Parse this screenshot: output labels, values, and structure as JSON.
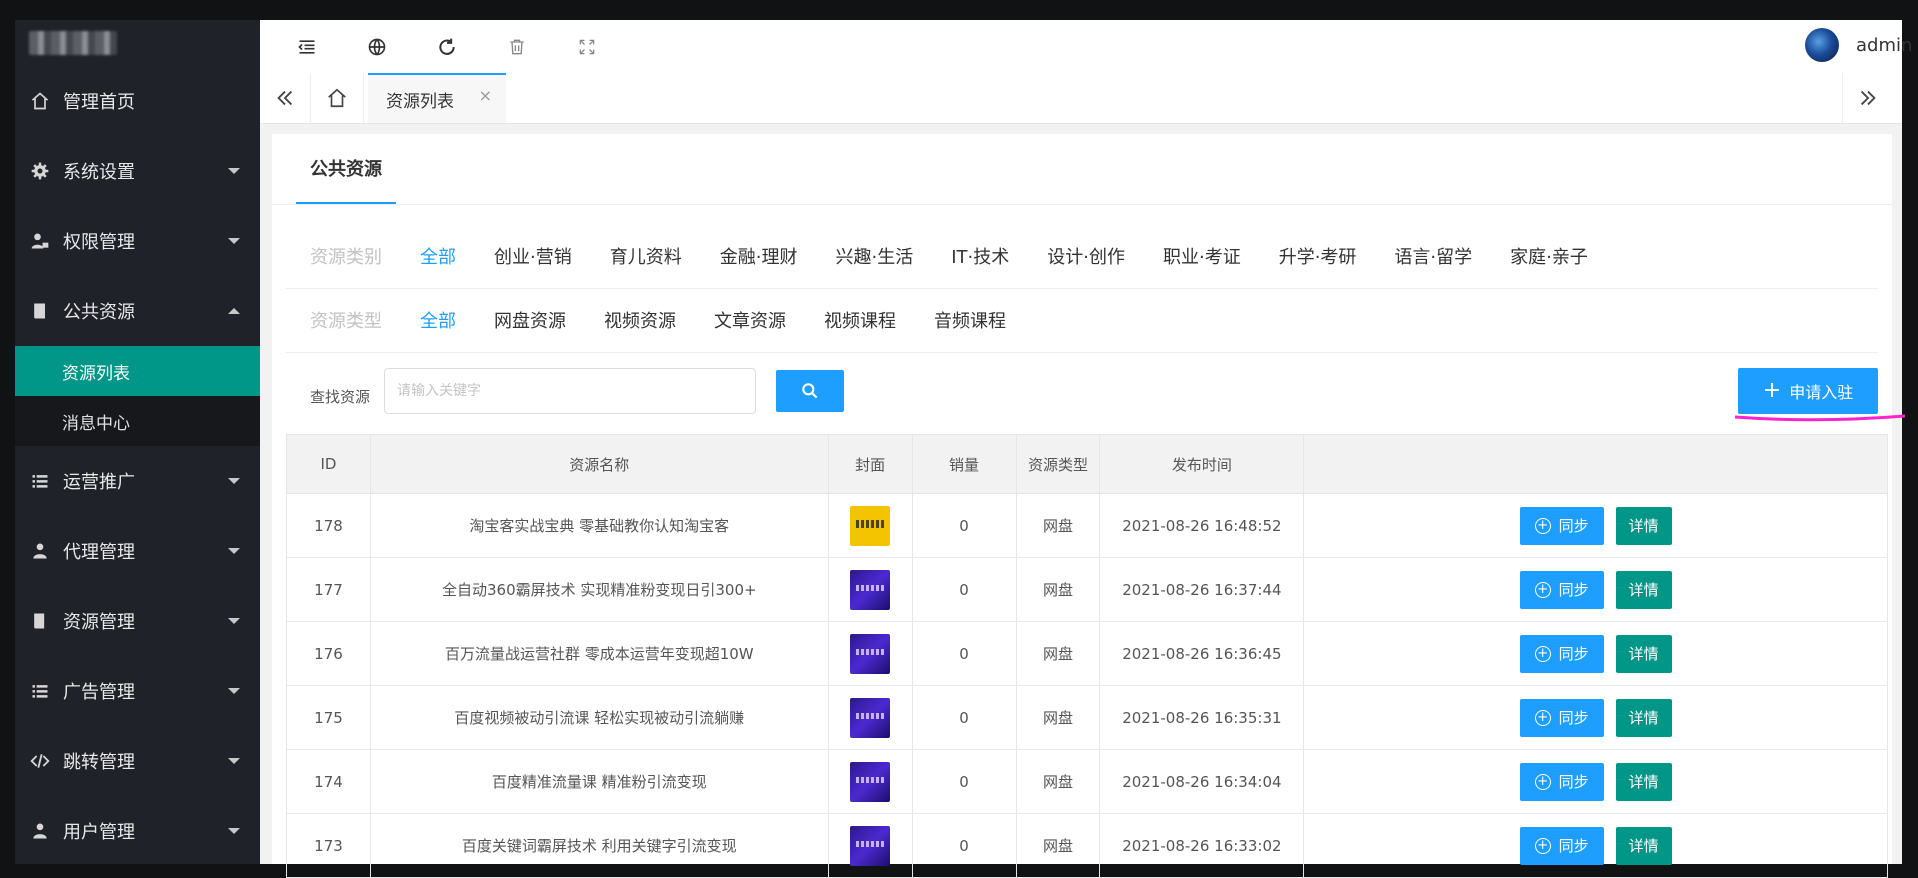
{
  "user": {
    "name": "admin"
  },
  "sidebar": {
    "items": [
      {
        "label": "管理首页",
        "icon": "home-icon",
        "expandable": false
      },
      {
        "label": "系统设置",
        "icon": "gear-icon",
        "expandable": true
      },
      {
        "label": "权限管理",
        "icon": "user-lock-icon",
        "expandable": true
      },
      {
        "label": "公共资源",
        "icon": "book-icon",
        "expandable": true,
        "open": true,
        "children": [
          {
            "label": "资源列表",
            "active": true
          },
          {
            "label": "消息中心"
          }
        ]
      },
      {
        "label": "运营推广",
        "icon": "list-icon",
        "expandable": true
      },
      {
        "label": "代理管理",
        "icon": "agent-icon",
        "expandable": true
      },
      {
        "label": "资源管理",
        "icon": "book-icon",
        "expandable": true
      },
      {
        "label": "广告管理",
        "icon": "list-icon",
        "expandable": true
      },
      {
        "label": "跳转管理",
        "icon": "code-icon",
        "expandable": true
      },
      {
        "label": "用户管理",
        "icon": "user-icon",
        "expandable": true
      }
    ]
  },
  "tabs": {
    "active_label": "资源列表",
    "close_glyph": "×"
  },
  "card": {
    "tab_label": "公共资源",
    "category": {
      "label": "资源类别",
      "options": [
        "全部",
        "创业·营销",
        "育儿资料",
        "金融·理财",
        "兴趣·生活",
        "IT·技术",
        "设计·创作",
        "职业·考证",
        "升学·考研",
        "语言·留学",
        "家庭·亲子"
      ],
      "active": 0
    },
    "type": {
      "label": "资源类型",
      "options": [
        "全部",
        "网盘资源",
        "视频资源",
        "文章资源",
        "视频课程",
        "音频课程"
      ],
      "active": 0
    },
    "search": {
      "label": "查找资源",
      "placeholder": "请输入关键字",
      "value": ""
    },
    "apply_label": "申请入驻"
  },
  "table": {
    "headers": [
      "ID",
      "资源名称",
      "封面",
      "销量",
      "资源类型",
      "发布时间",
      ""
    ],
    "sync_label": "同步",
    "detail_label": "详情",
    "rows": [
      {
        "id": "178",
        "name": "淘宝客实战宝典 零基础教你认知淘宝客",
        "sales": "0",
        "type": "网盘",
        "time": "2021-08-26 16:48:52",
        "cover": "yellow"
      },
      {
        "id": "177",
        "name": "全自动360霸屏技术 实现精准粉变现日引300+",
        "sales": "0",
        "type": "网盘",
        "time": "2021-08-26 16:37:44",
        "cover": "purple"
      },
      {
        "id": "176",
        "name": "百万流量战运营社群 零成本运营年变现超10W",
        "sales": "0",
        "type": "网盘",
        "time": "2021-08-26 16:36:45",
        "cover": "purple"
      },
      {
        "id": "175",
        "name": "百度视频被动引流课 轻松实现被动引流躺赚",
        "sales": "0",
        "type": "网盘",
        "time": "2021-08-26 16:35:31",
        "cover": "purple"
      },
      {
        "id": "174",
        "name": "百度精准流量课 精准粉引流变现",
        "sales": "0",
        "type": "网盘",
        "time": "2021-08-26 16:34:04",
        "cover": "purple"
      },
      {
        "id": "173",
        "name": "百度关键词霸屏技术 利用关键字引流变现",
        "sales": "0",
        "type": "网盘",
        "time": "2021-08-26 16:33:02",
        "cover": "purple"
      }
    ]
  },
  "colors": {
    "sidebar": "#20222a",
    "accent": "#1e9fff",
    "teal": "#009688",
    "annotation": "#ff22cc"
  }
}
